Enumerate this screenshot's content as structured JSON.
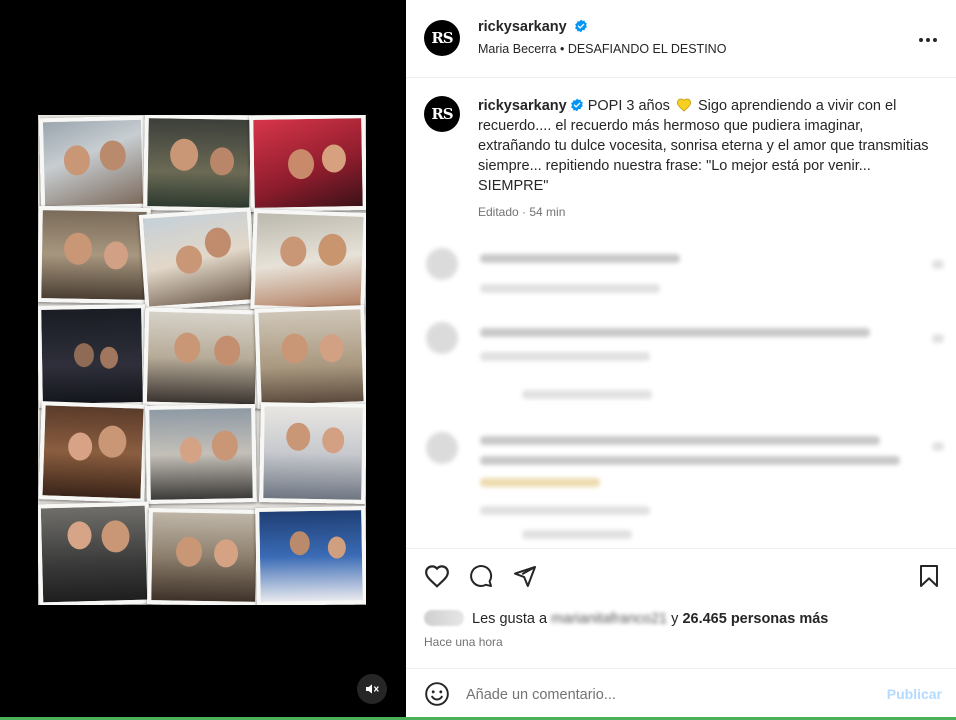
{
  "post": {
    "author": "rickysarkany",
    "author_initials": "RS",
    "music": "Maria Becerra • DESAFIANDO EL DESTINO",
    "caption_lead": "POPI 3 años",
    "caption_rest": "Sigo aprendiendo a vivir con el recuerdo.... el recuerdo más hermoso que pudiera imaginar, extrañando tu dulce vocesita, sonrisa eterna y el amor que transmitias siempre... repitiendo nuestra frase: \"Lo mejor está por venir... SIEMPRE\"",
    "edited_label": "Editado",
    "time_ago_short": "54 min",
    "likes_prefix": "Les gusta a",
    "likes_user": "marianitafranco21",
    "likes_suffix": "y",
    "likes_count": "26.465 personas más",
    "posted_ago": "Hace una hora"
  },
  "comment_box": {
    "placeholder": "Añade un comentario...",
    "publish_label": "Publicar"
  },
  "colors": {
    "verified": "#0095f6",
    "heart_emoji": "#f5d020",
    "publish_disabled": "#b3dbff",
    "muted_text": "#737373"
  },
  "icons": {
    "like": "heart-icon",
    "comment": "comment-bubble-icon",
    "share": "paper-plane-icon",
    "save": "bookmark-icon",
    "more": "more-options-icon",
    "mute": "speaker-muted-icon",
    "emoji": "smiley-icon"
  }
}
